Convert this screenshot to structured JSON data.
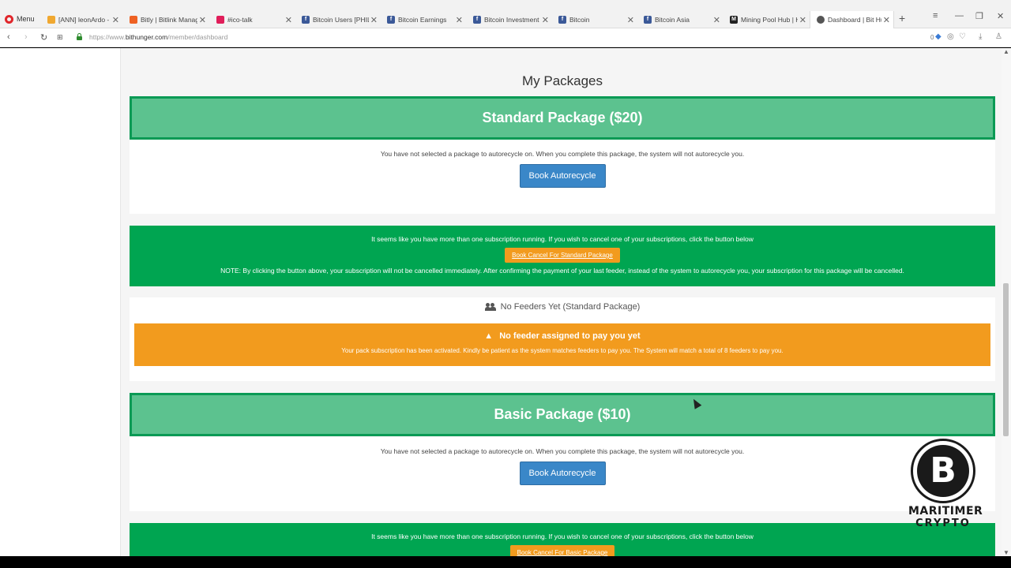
{
  "browser": {
    "menu_label": "Menu",
    "tabs": [
      {
        "title": "[ANN] leonArdo - R",
        "fav_color": "#f0a830",
        "fav_glyph": "",
        "active": false
      },
      {
        "title": "Bitly | Bitlink Manag",
        "fav_color": "#ee6123",
        "fav_glyph": "",
        "active": false
      },
      {
        "title": "#ico-talk",
        "fav_color": "#e01e5a",
        "fav_glyph": "",
        "active": false
      },
      {
        "title": "Bitcoin Users [PHILIP",
        "fav_color": "#3b5998",
        "fav_glyph": "f",
        "active": false
      },
      {
        "title": "Bitcoin Earnings",
        "fav_color": "#3b5998",
        "fav_glyph": "f",
        "active": false
      },
      {
        "title": "Bitcoin Investment",
        "fav_color": "#3b5998",
        "fav_glyph": "f",
        "active": false
      },
      {
        "title": "Bitcoin",
        "fav_color": "#3b5998",
        "fav_glyph": "f",
        "active": false
      },
      {
        "title": "Bitcoin Asia",
        "fav_color": "#3b5998",
        "fav_glyph": "f",
        "active": false
      },
      {
        "title": "Mining Pool Hub | H",
        "fav_color": "#222222",
        "fav_glyph": "M",
        "active": false
      },
      {
        "title": "Dashboard | Bit Hun",
        "fav_color": "#555555",
        "fav_glyph": "",
        "active": true
      }
    ],
    "url_prefix": "https://www.",
    "url_domain": "bithunger.com",
    "url_path": "/member/dashboard",
    "badge_count": "0"
  },
  "page": {
    "section_title": "My Packages",
    "packages": [
      {
        "name": "Standard Package ($20)",
        "autorecycle_note": "You have not selected a package to autorecycle on. When you complete this package, the system will not autorecycle you.",
        "autorecycle_button": "Book Autorecycle",
        "subscription_notice": "It seems like you have more than one subscription running. If you wish to cancel one of your subscriptions, click the button below",
        "cancel_button": "Book Cancel For Standard Package",
        "cancel_note": "NOTE: By clicking the button above, your subscription will not be cancelled immediately. After confirming the payment of your last feeder, instead of the system to autorecycle you, your subscription for this package will be cancelled.",
        "feeders_title": "No Feeders Yet (Standard Package)",
        "alert_title": "No feeder assigned to pay you yet",
        "alert_message": "Your pack subscription has been activated. Kindly be patient as the system matches feeders to pay you. The System will match a total of 8 feeders to pay you."
      },
      {
        "name": "Basic Package ($10)",
        "autorecycle_note": "You have not selected a package to autorecycle on. When you complete this package, the system will not autorecycle you.",
        "autorecycle_button": "Book Autorecycle",
        "subscription_notice": "It seems like you have more than one subscription running. If you wish to cancel one of your subscriptions, click the button below",
        "cancel_button": "Book Cancel For Basic Package"
      }
    ]
  },
  "overlay": {
    "logo_glyph": "B",
    "brand_line1": "MARITIMER",
    "brand_line2": "CRYPTO"
  },
  "colors": {
    "package_header_bg": "#5cc28f",
    "package_header_border": "#0a9a55",
    "subscription_bg": "#00a551",
    "warning_bg": "#f29b1e",
    "primary_button": "#3a87c8"
  }
}
